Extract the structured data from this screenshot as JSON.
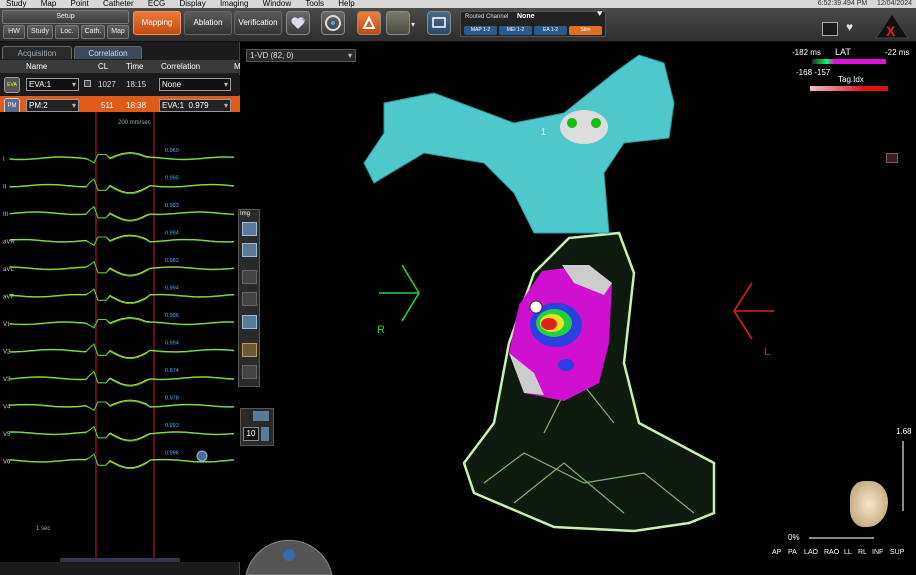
{
  "menu": [
    "Study",
    "Map",
    "Point",
    "Catheter",
    "ECG",
    "Display",
    "Imaging",
    "Window",
    "Tools",
    "Help"
  ],
  "clock": {
    "time": "6:52:39.494 PM",
    "date": "12/04/2024"
  },
  "toolbar": {
    "setup": "Setup",
    "hw": "HW",
    "study": "Study",
    "loc": "Loc.",
    "cath": "Cath.",
    "map": "Map",
    "mapping": "Mapping",
    "ablation": "Ablation",
    "verification": "Verification",
    "routed_label": "Routed Channel",
    "routed_value": "None",
    "chips": [
      "MAP 1-2",
      "MEI 1-2",
      "EA 1-2",
      "Stim"
    ]
  },
  "tabs": {
    "acquisition": "Acquisition",
    "correlation": "Correlation"
  },
  "table": {
    "headers": [
      "Name",
      "CL",
      "Time",
      "Correlation",
      "M"
    ],
    "rows": [
      {
        "icon": "EVA",
        "name": "EVA:1",
        "cl": "1027",
        "time": "18:15",
        "corr": "None",
        "score": ""
      },
      {
        "icon": "PM",
        "name": "PM:2",
        "cl": "511",
        "time": "18:38",
        "corr": "EVA:1",
        "score": "0.979"
      }
    ]
  },
  "ecg": {
    "speed": "200 mm/sec",
    "leads": [
      "I",
      "II",
      "III",
      "aVR",
      "aVL",
      "aVF",
      "V1",
      "V2",
      "V3",
      "V4",
      "V5",
      "V6"
    ],
    "scores": [
      "0.969",
      "0.995",
      "0.993",
      "0.994",
      "0.982",
      "0.994",
      "0.996",
      "0.994",
      "0.874",
      "0.978",
      "0.993",
      "0.996"
    ],
    "scale": "1 sec"
  },
  "view": {
    "selector": "1-VD (82, 0)",
    "lat_title": "LAT",
    "lat_min": "-182 ms",
    "lat_max": "-22 ms",
    "lat_sub": "-168 -157",
    "tag_idx": "Tag.Idx",
    "marker": "1",
    "r": "R",
    "l": "L",
    "img": "Img",
    "counter": "10",
    "zoom": "1.68",
    "pct": "0%",
    "views": [
      "AP",
      "PA",
      "LAO",
      "RAO",
      "LL",
      "RL",
      "INF",
      "SUP"
    ]
  },
  "colors": {
    "accent": "#e05a18",
    "aorta": "#4fc8cc",
    "magenta": "#d010d0",
    "green_mesh": "#c8f0b0"
  }
}
